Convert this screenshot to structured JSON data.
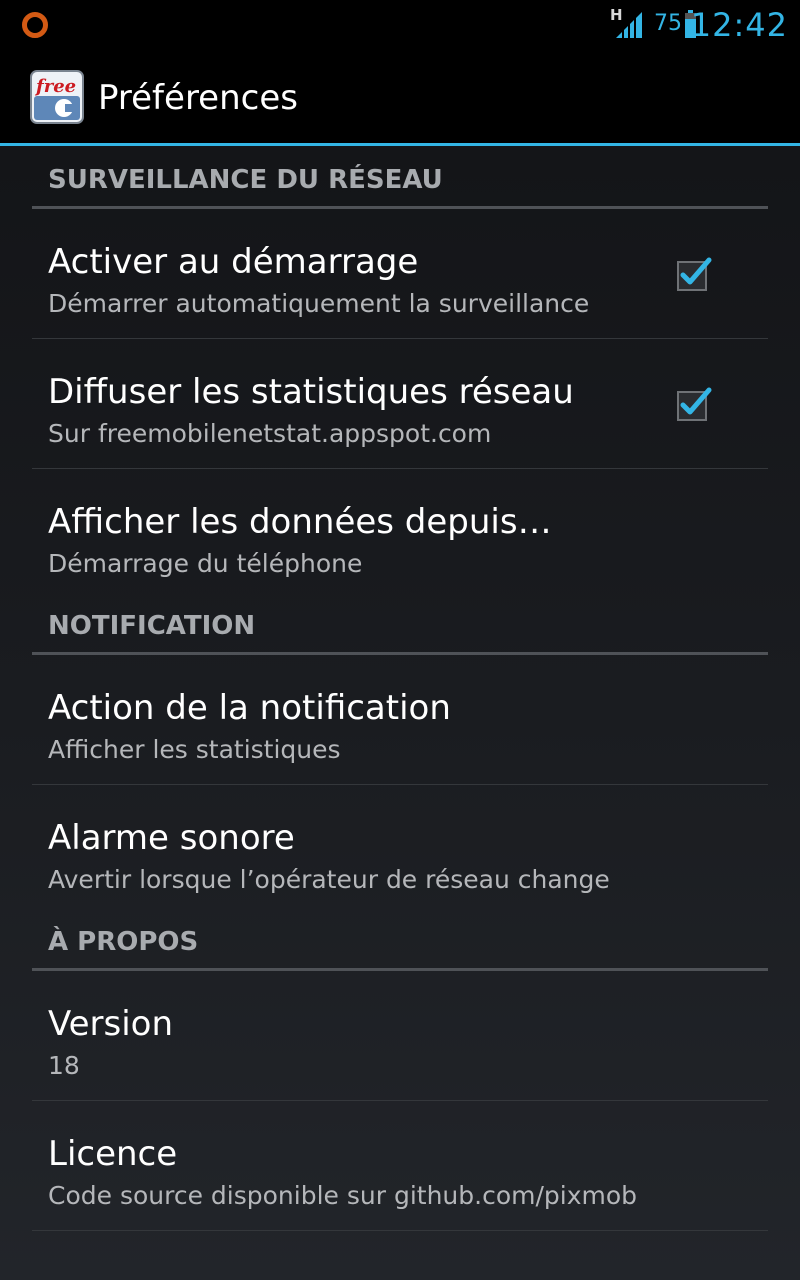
{
  "status_bar": {
    "network_type": "H",
    "battery_percent": "75",
    "clock": "12:42",
    "icons": [
      "notification-circle-icon",
      "signal-icon",
      "battery-icon"
    ],
    "accent_color": "#33b5e5"
  },
  "action_bar": {
    "title": "Préférences",
    "app_icon": "free-app-icon",
    "app_icon_text": "free"
  },
  "sections": [
    {
      "header": "SURVEILLANCE DU RÉSEAU",
      "items": [
        {
          "title": "Activer au démarrage",
          "summary": "Démarrer automatiquement la surveillance",
          "checked": true
        },
        {
          "title": "Diffuser les statistiques réseau",
          "summary": "Sur freemobilenetstat.appspot.com",
          "checked": true
        },
        {
          "title": "Afficher les données depuis…",
          "summary": "Démarrage du téléphone"
        }
      ]
    },
    {
      "header": "NOTIFICATION",
      "items": [
        {
          "title": "Action de la notification",
          "summary": "Afficher les statistiques"
        },
        {
          "title": "Alarme sonore",
          "summary": "Avertir lorsque l’opérateur de réseau change"
        }
      ]
    },
    {
      "header": "À PROPOS",
      "items": [
        {
          "title": "Version",
          "summary": "18"
        },
        {
          "title": "Licence",
          "summary": "Code source disponible sur github.com/pixmob"
        }
      ]
    }
  ]
}
